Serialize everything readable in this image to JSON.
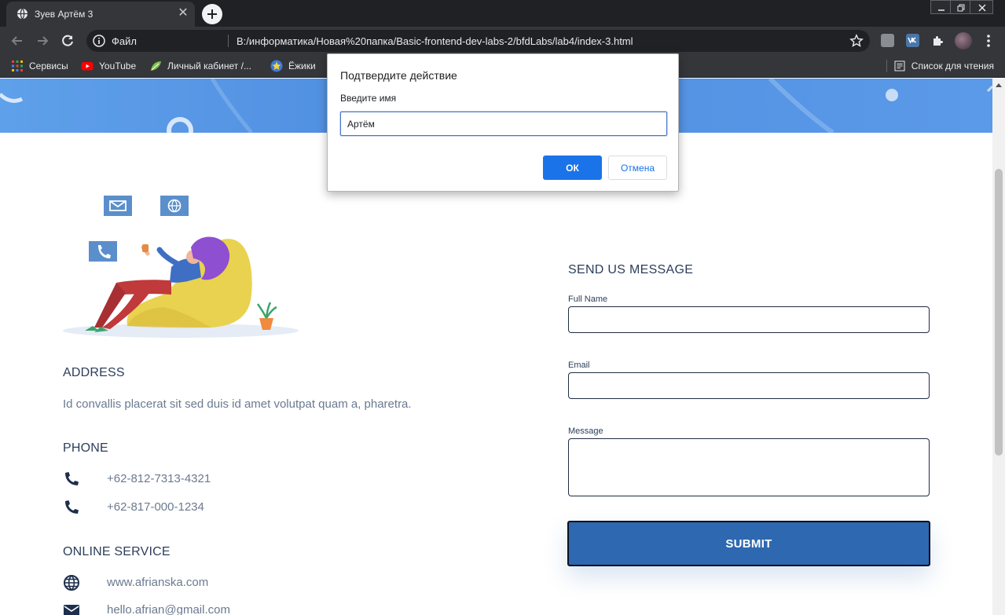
{
  "browser": {
    "tab_title": "Зуев Артём 3",
    "tab_close": "✕",
    "url_scheme": "Файл",
    "url": "B:/информатика/Новая%20папка/Basic-frontend-dev-labs-2/bfdLabs/lab4/index-3.html",
    "bookmarks": [
      {
        "label": "Сервисы"
      },
      {
        "label": "YouTube"
      },
      {
        "label": "Личный кабинет /..."
      },
      {
        "label": "Ёжики"
      }
    ],
    "reading_list": "Список для чтения"
  },
  "dialog": {
    "title": "Подтвердите действие",
    "message": "Введите имя",
    "input_value": "Артём",
    "ok_label": "ОК",
    "cancel_label": "Отмена"
  },
  "contact": {
    "address_heading": "ADDRESS",
    "address_text": "Id convallis placerat sit sed duis id amet volutpat quam a, pharetra.",
    "phone_heading": "PHONE",
    "phones": [
      "+62-812-7313-4321",
      "+62-817-000-1234"
    ],
    "online_heading": "ONLINE SERVICE",
    "website": "www.afrianska.com",
    "email": "hello.afrian@gmail.com"
  },
  "form": {
    "title": "SEND US MESSAGE",
    "full_name_label": "Full Name",
    "email_label": "Email",
    "message_label": "Message",
    "submit_label": "SUBMIT"
  },
  "colors": {
    "accent": "#2e68b0",
    "heading": "#2c3e5a",
    "chrome_dark": "#202124",
    "chrome_toolbar": "#35363a",
    "dialog_ok": "#1a73e8"
  }
}
